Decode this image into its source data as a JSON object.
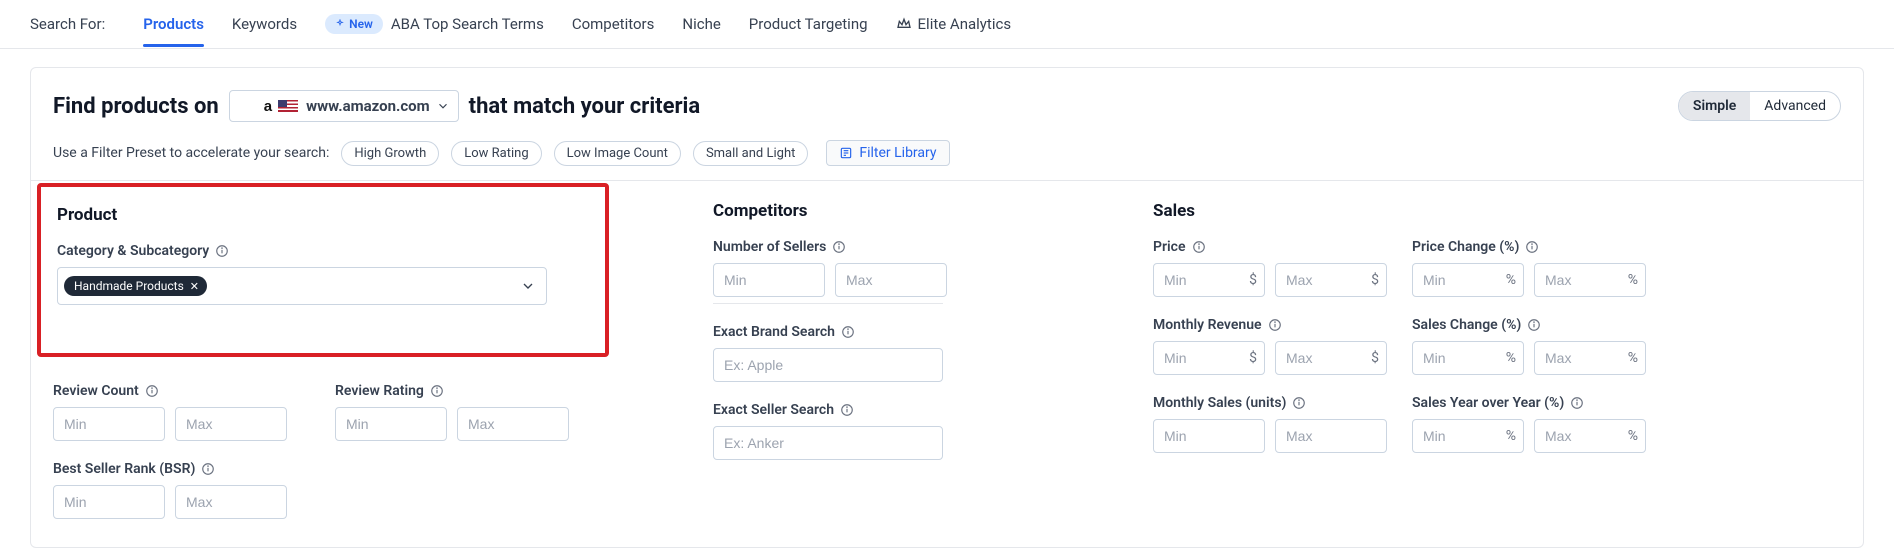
{
  "tabs": {
    "search_for_label": "Search For:",
    "items": [
      "Products",
      "Keywords",
      "ABA Top Search Terms",
      "Competitors",
      "Niche",
      "Product Targeting",
      "Elite Analytics"
    ],
    "active_index": 0,
    "new_badge": "New"
  },
  "header": {
    "title_pre": "Find products on",
    "title_post": "that match your criteria",
    "market_domain": "www.amazon.com",
    "mode_simple": "Simple",
    "mode_advanced": "Advanced",
    "mode_active": "simple"
  },
  "presets": {
    "label": "Use a Filter Preset to accelerate your search:",
    "chips": [
      "High Growth",
      "Low Rating",
      "Low Image Count",
      "Small and Light"
    ],
    "filter_library": "Filter Library"
  },
  "sections": {
    "product": {
      "title": "Product",
      "category_label": "Category & Subcategory",
      "category_tag": "Handmade Products",
      "review_count_label": "Review Count",
      "review_rating_label": "Review Rating",
      "bsr_label": "Best Seller Rank (BSR)"
    },
    "competitors": {
      "title": "Competitors",
      "num_sellers_label": "Number of Sellers",
      "exact_brand_label": "Exact Brand Search",
      "exact_brand_placeholder": "Ex: Apple",
      "exact_seller_label": "Exact Seller Search",
      "exact_seller_placeholder": "Ex: Anker"
    },
    "sales": {
      "title": "Sales",
      "price_label": "Price",
      "price_change_label": "Price Change (%)",
      "monthly_revenue_label": "Monthly Revenue",
      "sales_change_label": "Sales Change (%)",
      "monthly_sales_label": "Monthly Sales (units)",
      "sales_yoy_label": "Sales Year over Year (%)"
    }
  },
  "placeholders": {
    "min": "Min",
    "max": "Max"
  },
  "suffixes": {
    "dollar": "$",
    "percent": "%"
  }
}
